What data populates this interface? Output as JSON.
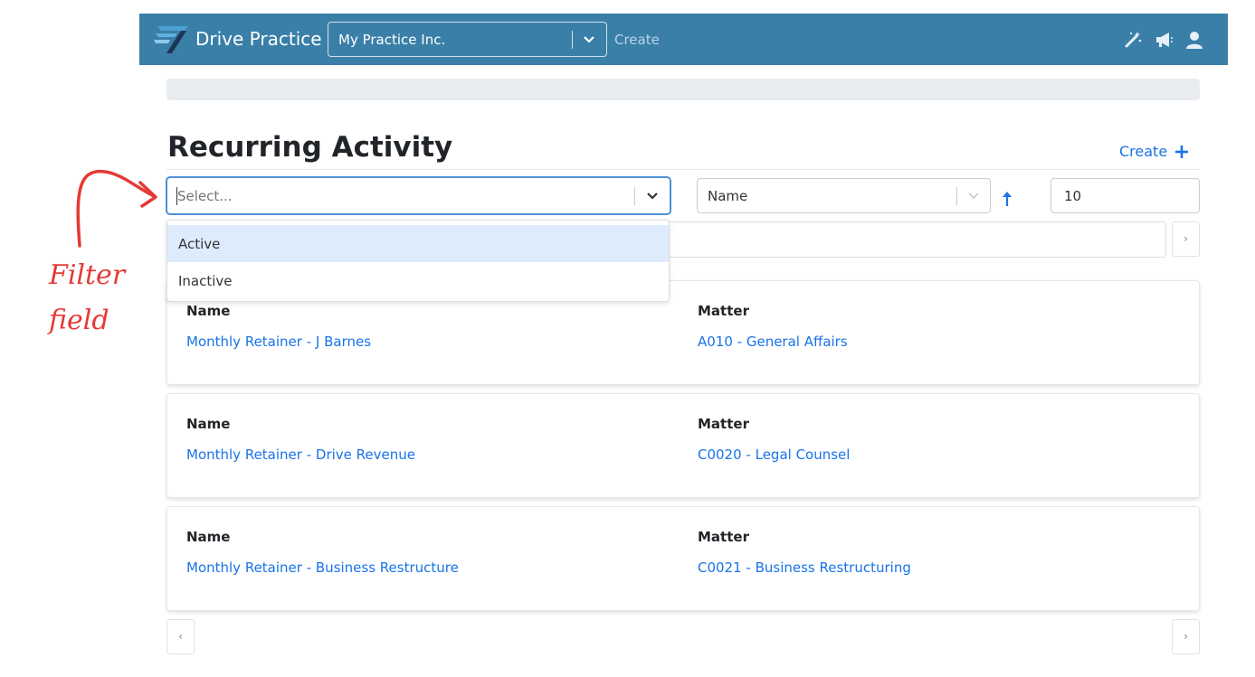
{
  "app": {
    "name": "Drive Practice"
  },
  "navbar": {
    "practice_select": "My Practice Inc.",
    "create_label": "Create",
    "icons": [
      "magic-wand-icon",
      "megaphone-icon",
      "user-icon"
    ]
  },
  "page": {
    "title": "Recurring Activity",
    "create_label": "Create"
  },
  "filters": {
    "status_placeholder": "Select...",
    "status_options": [
      "Active",
      "Inactive"
    ],
    "sort_by": "Name",
    "page_size": "10"
  },
  "cards": [
    {
      "name_label": "Name",
      "name": "Monthly Retainer - J Barnes",
      "matter_label": "Matter",
      "matter": "A010 - General Affairs"
    },
    {
      "name_label": "Name",
      "name": "Monthly Retainer - Drive Revenue",
      "matter_label": "Matter",
      "matter": "C0020 - Legal Counsel"
    },
    {
      "name_label": "Name",
      "name": "Monthly Retainer - Business Restructure",
      "matter_label": "Matter",
      "matter": "C0021 - Business Restructuring"
    }
  ],
  "pager": {
    "prev": "‹",
    "next": "›"
  },
  "annotation": {
    "line1": "Filter",
    "line2": "field",
    "color": "#e53935"
  },
  "colors": {
    "navbar": "#3a7fa8",
    "link": "#1a73e8",
    "focus": "#4d90d8",
    "option_highlight": "#deebfd"
  }
}
